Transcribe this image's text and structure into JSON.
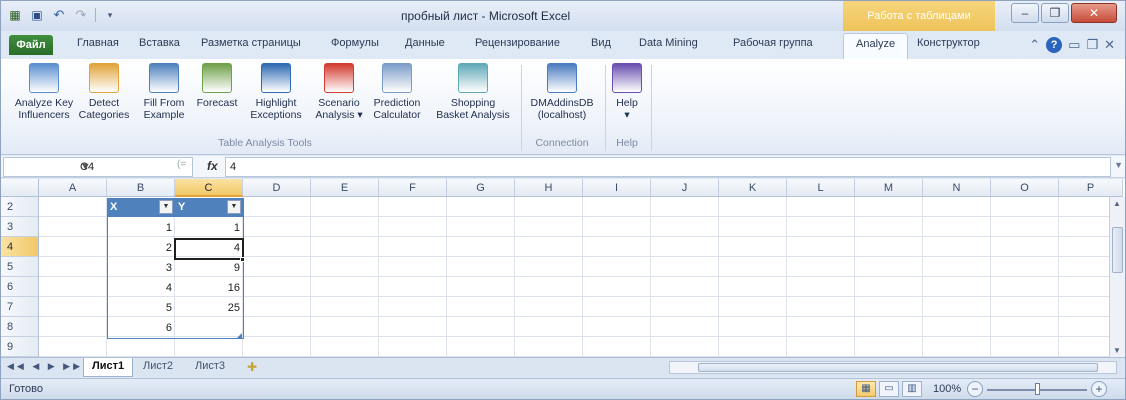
{
  "titlebar": {
    "title": "пробный лист - Microsoft Excel",
    "context_tab_group": "Работа с таблицами",
    "minimize": "‒",
    "maximize": "❐",
    "close": "✕"
  },
  "ribbon_tabs": [
    {
      "label": "Файл"
    },
    {
      "label": "Главная"
    },
    {
      "label": "Вставка"
    },
    {
      "label": "Разметка страницы"
    },
    {
      "label": "Формулы"
    },
    {
      "label": "Данные"
    },
    {
      "label": "Рецензирование"
    },
    {
      "label": "Вид"
    },
    {
      "label": "Data Mining"
    },
    {
      "label": "Рабочая группа"
    },
    {
      "label": "Analyze"
    },
    {
      "label": "Конструктор"
    }
  ],
  "ribbon": {
    "buttons": [
      {
        "label1": "Analyze Key",
        "label2": "Influencers",
        "color": "#5b8fd0"
      },
      {
        "label1": "Detect",
        "label2": "Categories",
        "color": "#e0a43a"
      },
      {
        "label1": "Fill From",
        "label2": "Example",
        "color": "#4f81bd"
      },
      {
        "label1": "Forecast",
        "label2": "",
        "color": "#6fa04a"
      },
      {
        "label1": "Highlight",
        "label2": "Exceptions",
        "color": "#2f6ab3"
      },
      {
        "label1": "Scenario",
        "label2": "Analysis ▾",
        "color": "#d23b2f"
      },
      {
        "label1": "Prediction",
        "label2": "Calculator",
        "color": "#7a9cc8"
      },
      {
        "label1": "Shopping",
        "label2": "Basket Analysis",
        "color": "#5fa8b8"
      },
      {
        "label1": "DMAddinsDB",
        "label2": "(localhost)",
        "color": "#4b7bc0"
      },
      {
        "label1": "Help",
        "label2": "▾",
        "color": "#6a4fb0"
      }
    ],
    "groups": [
      {
        "label": "Table Analysis Tools"
      },
      {
        "label": "Connection"
      },
      {
        "label": "Help"
      }
    ]
  },
  "formula_bar": {
    "name_box": "C4",
    "fx": "fx",
    "value": "4"
  },
  "grid": {
    "columns": [
      "A",
      "B",
      "C",
      "D",
      "E",
      "F",
      "G",
      "H",
      "I",
      "J",
      "K",
      "L",
      "M",
      "N",
      "O",
      "P"
    ],
    "rows": [
      "2",
      "3",
      "4",
      "5",
      "6",
      "7",
      "8",
      "9"
    ],
    "active_column": "C",
    "active_row": "4"
  },
  "table": {
    "headers": [
      "X",
      "Y"
    ],
    "rows": [
      {
        "x": "1",
        "y": "1"
      },
      {
        "x": "2",
        "y": "4"
      },
      {
        "x": "3",
        "y": "9"
      },
      {
        "x": "4",
        "y": "16"
      },
      {
        "x": "5",
        "y": "25"
      },
      {
        "x": "6",
        "y": ""
      }
    ],
    "header_color": "#4f81bd"
  },
  "sheets": [
    {
      "name": "Лист1"
    },
    {
      "name": "Лист2"
    },
    {
      "name": "Лист3"
    }
  ],
  "status": {
    "ready": "Готово",
    "zoom": "100%"
  },
  "colors": {
    "selection_highlight": "#f2c868",
    "table_header": "#4f81bd",
    "file_tab": "#2a6d2a"
  }
}
